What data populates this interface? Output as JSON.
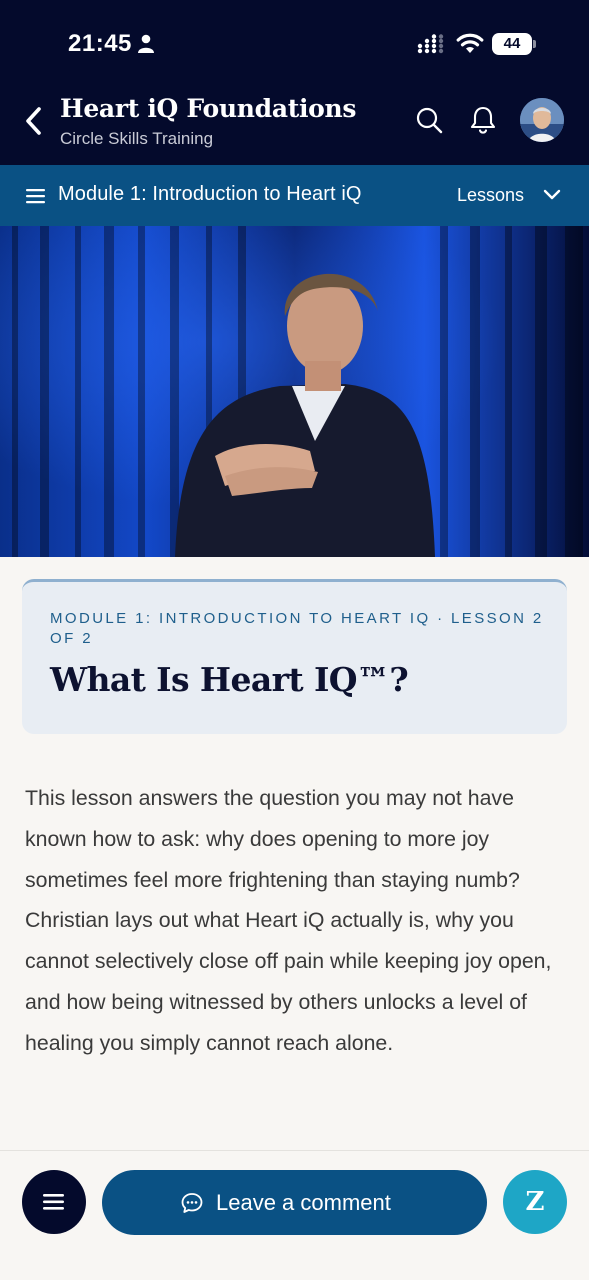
{
  "status_bar": {
    "time": "21:45",
    "battery": "44"
  },
  "header": {
    "title": "Heart iQ Foundations",
    "subtitle": "Circle Skills Training"
  },
  "module_bar": {
    "title": "Module 1: Introduction to Heart iQ",
    "lessons_label": "Lessons"
  },
  "lesson": {
    "meta": "MODULE 1: INTRODUCTION TO HEART IQ · LESSON 2 OF 2",
    "title": "What Is Heart IQ™?",
    "description": "This lesson answers the question you may not have known how to ask: why does opening to more joy sometimes feel more frightening than staying numb? Christian lays out what Heart iQ actually is, why you cannot selectively close off pain while keeping joy open, and how being witnessed by others unlocks a level of healing you simply cannot reach alone."
  },
  "bottom_bar": {
    "comment_label": "Leave a comment",
    "z_label": "Z"
  },
  "colors": {
    "header_bg": "#040a2c",
    "module_bar_bg": "#0a5184",
    "card_bg": "#e8edf3",
    "z_button": "#1ea6c6"
  },
  "icons": [
    "person-icon",
    "cellular-signal-icon",
    "wifi-icon",
    "battery-icon",
    "back-chevron-icon",
    "search-icon",
    "bell-icon",
    "hamburger-menu-icon",
    "chevron-down-icon",
    "chat-bubble-icon"
  ]
}
